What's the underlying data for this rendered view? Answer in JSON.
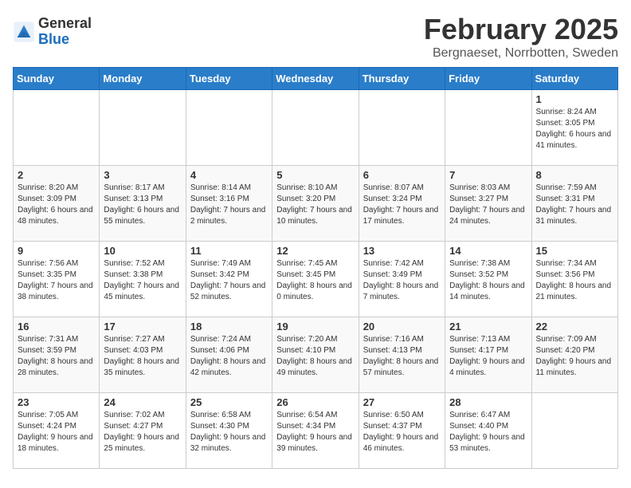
{
  "logo": {
    "general": "General",
    "blue": "Blue"
  },
  "title": {
    "month": "February 2025",
    "location": "Bergnaeset, Norrbotten, Sweden"
  },
  "days_of_week": [
    "Sunday",
    "Monday",
    "Tuesday",
    "Wednesday",
    "Thursday",
    "Friday",
    "Saturday"
  ],
  "weeks": [
    [
      {
        "day": "",
        "info": ""
      },
      {
        "day": "",
        "info": ""
      },
      {
        "day": "",
        "info": ""
      },
      {
        "day": "",
        "info": ""
      },
      {
        "day": "",
        "info": ""
      },
      {
        "day": "",
        "info": ""
      },
      {
        "day": "1",
        "info": "Sunrise: 8:24 AM\nSunset: 3:05 PM\nDaylight: 6 hours and 41 minutes."
      }
    ],
    [
      {
        "day": "2",
        "info": "Sunrise: 8:20 AM\nSunset: 3:09 PM\nDaylight: 6 hours and 48 minutes."
      },
      {
        "day": "3",
        "info": "Sunrise: 8:17 AM\nSunset: 3:13 PM\nDaylight: 6 hours and 55 minutes."
      },
      {
        "day": "4",
        "info": "Sunrise: 8:14 AM\nSunset: 3:16 PM\nDaylight: 7 hours and 2 minutes."
      },
      {
        "day": "5",
        "info": "Sunrise: 8:10 AM\nSunset: 3:20 PM\nDaylight: 7 hours and 10 minutes."
      },
      {
        "day": "6",
        "info": "Sunrise: 8:07 AM\nSunset: 3:24 PM\nDaylight: 7 hours and 17 minutes."
      },
      {
        "day": "7",
        "info": "Sunrise: 8:03 AM\nSunset: 3:27 PM\nDaylight: 7 hours and 24 minutes."
      },
      {
        "day": "8",
        "info": "Sunrise: 7:59 AM\nSunset: 3:31 PM\nDaylight: 7 hours and 31 minutes."
      }
    ],
    [
      {
        "day": "9",
        "info": "Sunrise: 7:56 AM\nSunset: 3:35 PM\nDaylight: 7 hours and 38 minutes."
      },
      {
        "day": "10",
        "info": "Sunrise: 7:52 AM\nSunset: 3:38 PM\nDaylight: 7 hours and 45 minutes."
      },
      {
        "day": "11",
        "info": "Sunrise: 7:49 AM\nSunset: 3:42 PM\nDaylight: 7 hours and 52 minutes."
      },
      {
        "day": "12",
        "info": "Sunrise: 7:45 AM\nSunset: 3:45 PM\nDaylight: 8 hours and 0 minutes."
      },
      {
        "day": "13",
        "info": "Sunrise: 7:42 AM\nSunset: 3:49 PM\nDaylight: 8 hours and 7 minutes."
      },
      {
        "day": "14",
        "info": "Sunrise: 7:38 AM\nSunset: 3:52 PM\nDaylight: 8 hours and 14 minutes."
      },
      {
        "day": "15",
        "info": "Sunrise: 7:34 AM\nSunset: 3:56 PM\nDaylight: 8 hours and 21 minutes."
      }
    ],
    [
      {
        "day": "16",
        "info": "Sunrise: 7:31 AM\nSunset: 3:59 PM\nDaylight: 8 hours and 28 minutes."
      },
      {
        "day": "17",
        "info": "Sunrise: 7:27 AM\nSunset: 4:03 PM\nDaylight: 8 hours and 35 minutes."
      },
      {
        "day": "18",
        "info": "Sunrise: 7:24 AM\nSunset: 4:06 PM\nDaylight: 8 hours and 42 minutes."
      },
      {
        "day": "19",
        "info": "Sunrise: 7:20 AM\nSunset: 4:10 PM\nDaylight: 8 hours and 49 minutes."
      },
      {
        "day": "20",
        "info": "Sunrise: 7:16 AM\nSunset: 4:13 PM\nDaylight: 8 hours and 57 minutes."
      },
      {
        "day": "21",
        "info": "Sunrise: 7:13 AM\nSunset: 4:17 PM\nDaylight: 9 hours and 4 minutes."
      },
      {
        "day": "22",
        "info": "Sunrise: 7:09 AM\nSunset: 4:20 PM\nDaylight: 9 hours and 11 minutes."
      }
    ],
    [
      {
        "day": "23",
        "info": "Sunrise: 7:05 AM\nSunset: 4:24 PM\nDaylight: 9 hours and 18 minutes."
      },
      {
        "day": "24",
        "info": "Sunrise: 7:02 AM\nSunset: 4:27 PM\nDaylight: 9 hours and 25 minutes."
      },
      {
        "day": "25",
        "info": "Sunrise: 6:58 AM\nSunset: 4:30 PM\nDaylight: 9 hours and 32 minutes."
      },
      {
        "day": "26",
        "info": "Sunrise: 6:54 AM\nSunset: 4:34 PM\nDaylight: 9 hours and 39 minutes."
      },
      {
        "day": "27",
        "info": "Sunrise: 6:50 AM\nSunset: 4:37 PM\nDaylight: 9 hours and 46 minutes."
      },
      {
        "day": "28",
        "info": "Sunrise: 6:47 AM\nSunset: 4:40 PM\nDaylight: 9 hours and 53 minutes."
      },
      {
        "day": "",
        "info": ""
      }
    ]
  ]
}
